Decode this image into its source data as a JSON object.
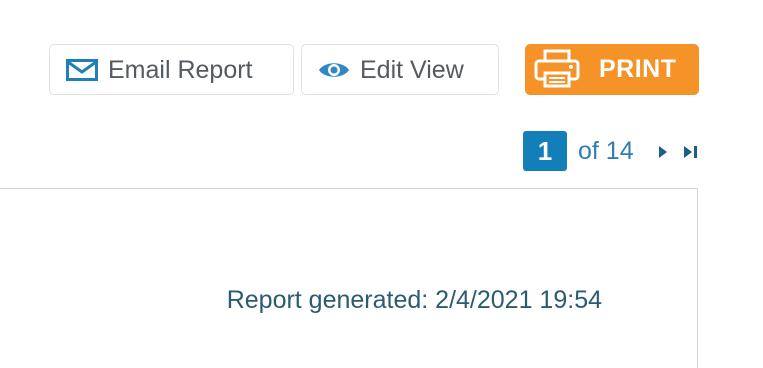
{
  "toolbar": {
    "email_label": "Email Report",
    "edit_label": "Edit View",
    "print_label": "PRINT"
  },
  "icons": {
    "email": "envelope-icon",
    "edit": "eye-icon",
    "print": "printer-icon",
    "next": "play-next-icon",
    "last": "skip-last-icon"
  },
  "pager": {
    "current_page": "1",
    "of_text": "of 14"
  },
  "report": {
    "generated_text": "Report generated: 2/4/2021 19:54"
  },
  "colors": {
    "print_bg": "#f59228",
    "page_box_bg": "#127fb8",
    "link_blue": "#2f7fb0",
    "icon_blue": "#1f7fb8"
  }
}
